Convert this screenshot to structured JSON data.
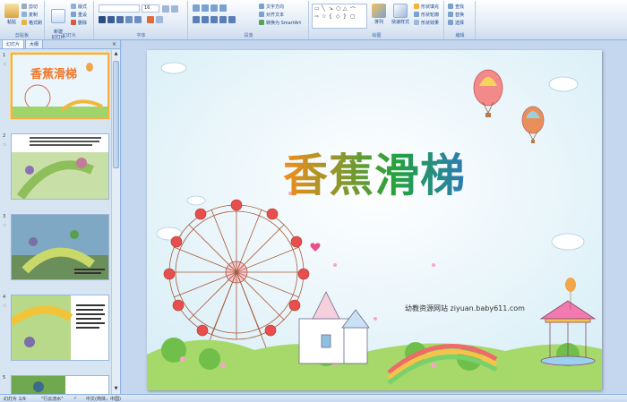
{
  "ribbon": {
    "clipboard": {
      "label": "剪贴板",
      "paste": "粘贴",
      "cut": "剪切",
      "copy": "复制",
      "format_painter": "格式刷"
    },
    "slides": {
      "label": "幻灯片",
      "new_slide": "新建\n幻灯片",
      "layout": "版式",
      "reset": "重设",
      "delete": "删除"
    },
    "font": {
      "label": "字体",
      "font_name": "",
      "font_size": "16"
    },
    "paragraph": {
      "label": "段落",
      "text_direction": "文字方向",
      "align_text": "对齐文本",
      "smartart": "转换为 SmartArt"
    },
    "drawing": {
      "label": "绘图",
      "arrange": "排列",
      "quick_styles": "快速样式",
      "shape_fill": "形状填充",
      "shape_outline": "形状轮廓",
      "shape_effects": "形状效果"
    },
    "editing": {
      "label": "编辑",
      "find": "查找",
      "replace": "替换",
      "select": "选择"
    }
  },
  "left_pane": {
    "tabs": [
      "幻灯片",
      "大纲"
    ],
    "close": "×",
    "slide_numbers": [
      "1",
      "2",
      "3",
      "4",
      "5"
    ],
    "star": "☆"
  },
  "slide": {
    "title": "香蕉滑梯",
    "footer": "幼教资源网站  ziyuan.baby611.com"
  },
  "status": {
    "slide_count": "幻灯片 1/9",
    "theme": "\"行云流水\"",
    "language": "中文(简体，中国)"
  },
  "colors": {
    "ribbon_border": "#8db2e3",
    "selection": "#f5b041",
    "workspace": "#c5d7ee"
  }
}
